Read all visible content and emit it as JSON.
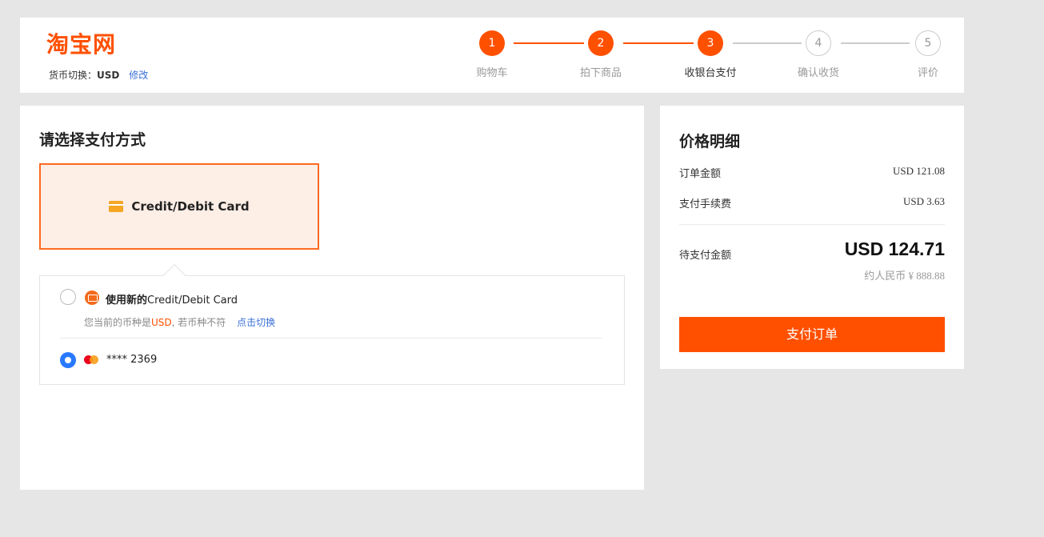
{
  "header": {
    "logo": "淘宝网",
    "currency_label": "货币切换：",
    "currency_code": "USD",
    "currency_edit": "修改"
  },
  "steps": [
    {
      "num": "1",
      "label": "购物车",
      "state": "done"
    },
    {
      "num": "2",
      "label": "拍下商品",
      "state": "done"
    },
    {
      "num": "3",
      "label": "收银台支付",
      "state": "current"
    },
    {
      "num": "4",
      "label": "确认收货",
      "state": "todo"
    },
    {
      "num": "5",
      "label": "评价",
      "state": "todo"
    }
  ],
  "payment": {
    "title": "请选择支付方式",
    "method_label": "Credit/Debit Card",
    "new_card_bold": "使用新的",
    "new_card_text": "Credit/Debit Card",
    "note_prefix": "您当前的币种是",
    "note_currency": "USD",
    "note_suffix": ", 若币种不符",
    "note_link": "点击切换",
    "saved_card": "**** 2369",
    "selected": "saved_card"
  },
  "price": {
    "title": "价格明细",
    "order_label": "订单金额",
    "order_value": "USD 121.08",
    "fee_label": "支付手续费",
    "fee_value": "USD 3.63",
    "total_label": "待支付金额",
    "total_value": "USD 124.71",
    "rmb_value": "约人民币 ¥ 888.88",
    "pay_button": "支付订单"
  },
  "colors": {
    "accent": "#ff5000",
    "link": "#3a6fd8",
    "radio_selected": "#2979ff"
  }
}
